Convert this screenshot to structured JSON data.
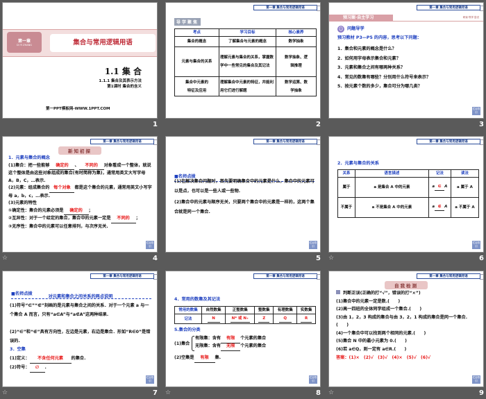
{
  "header_badge": "第一章 集合与常用逻辑用语",
  "nav_label": "栏目导引",
  "slides": [
    {
      "number": "1",
      "chapter": "第一章",
      "chapter_pinyin": "DI YI ZHANG",
      "chapter_title": "集合与常用逻辑用语",
      "section": "1.1 集 合",
      "subsection": "1.1.1 集合及其表示方法",
      "lesson": "第1课时 集合的含义",
      "footer": "第一PPT模板网-WWW.1PPT.COM"
    },
    {
      "number": "2",
      "tag": "导学聚焦",
      "headers": [
        "考点",
        "学习目标",
        "核心素养"
      ],
      "rows": [
        [
          "集合的概念",
          "了解集合与元素的概念",
          "数学抽象"
        ],
        [
          "元素与集合的关系",
          "理解元素与集合的关系，掌握数学中一些常见的集合及其记法",
          "数学抽象、逻辑推理"
        ],
        [
          "集合中元素的特征及应用",
          "理解集合中元素的特征，并能利用它们进行解题",
          "数学运算、数学抽象"
        ]
      ]
    },
    {
      "number": "3",
      "banner": "预习案·自主学习",
      "banner_right": "研读·导学·尝试",
      "heading": "问题导学",
      "intro": "预习教材 P3—P5 的内容，思考以下问题：",
      "questions": [
        "1．集合和元素的概念是什么？",
        "2．如何用字母表示集合和元素？",
        "3．元素和集合之间有哪两种关系？",
        "4．常见的数集有哪些？分别用什么符号来表示？",
        "5．按元素个数的多少，集合可分为哪几类？"
      ]
    },
    {
      "number": "4",
      "ribbon": "新知初探",
      "heading": "1．元素与集合的概念",
      "l1a": "(1)集合：把一些能够",
      "b1": "确定的",
      "l1b": "、",
      "b2": "不同的",
      "l1c": "对象看成一个整体，就说这个整体是由这些对象组成的集合(有时简称为集)，通常用英文大写字母 A，B，C，…表示.",
      "l2a": "(2)元素：组成集合的",
      "b3": "每个对象",
      "l2b": "都是这个集合的元素，通常用英文小写字母 a，b，c，…表示.",
      "l3": "(3)元素的特性",
      "l4a": "①确定性：集合的元素必须是",
      "b4": "确定的",
      "l4b": "；",
      "l5": "②互异性：对于一个给定的集合，集合中的元素一定是",
      "b5": "不同的",
      "l5b": "；",
      "l6": "③无序性：集合中的元素可以任意排列，与次序无关."
    },
    {
      "number": "5",
      "heading": "■名师点拨",
      "p1": "(1)在解决集合问题时，首先要明确集合中的元素是什么，集合中的元素可以是点，也可以是一些人或一些物.",
      "p2": "(2)集合中的元素与顺序无关，只要两个集合中的元素是一样的，这两个集合就是同一个集合."
    },
    {
      "number": "6",
      "heading": "2．元素与集合的关系",
      "headers": [
        "关系",
        "语言描述",
        "记法",
        "读法"
      ],
      "rows": [
        [
          "属于",
          "a 是集合 A 中的元素",
          "a",
          "∈",
          "A",
          "a 属于 A"
        ],
        [
          "不属于",
          "a 不是集合 A 中的元素",
          "a",
          "∉",
          "A",
          "a 不属于 A"
        ]
      ]
    },
    {
      "number": "7",
      "heading": "■名师点拨",
      "subheading": "对元素和集合之间关系的两点说明",
      "p1": "(1)符号“∈”“∉”刻画的是元素与集合之间的关系．对于一个元素 a 与一个集合 A 而言，只有“a∈A”与“a∉A”这两种结果.",
      "p2": "(2)“∈”和“∉”具有方向性，左边是元素，右边是集合．形如“R∈0”是错误的.",
      "h2": "3．空集",
      "d1a": "(1)定义：",
      "d1b": "不含任何元素",
      "d1c": "的集合.",
      "d2a": "(2)符号：",
      "d2b": "∅",
      "d2c": "."
    },
    {
      "number": "8",
      "heading": "4．常用的数集及其记法",
      "headers": [
        "常用的数集",
        "自然数集",
        "正整数集",
        "整数集",
        "有理数集",
        "实数集"
      ],
      "row": [
        "记法",
        "N",
        "N* 或 N₊",
        "Z",
        "Q",
        "R"
      ],
      "h2": "5.集合的分类",
      "c1": "(1)集合",
      "c1a": "有限集：含有",
      "c1ab": "有限",
      "c1b": "无限集：含有",
      "c1bb": "无限",
      "c1tail": "个元素的集合",
      "c2a": "(2)空集是",
      "c2b": "有限",
      "c2c": "集."
    },
    {
      "number": "9",
      "ribbon": "自我检测",
      "intro": "判断正误(正确的打“√”，错误的打“×”)",
      "items": [
        "(1)集合中的元素一定是数.(　　)",
        "(2)高一四班的全体同学组成一个集合.(　　)",
        "(3)由 1，2，3 构成的集合与由 3，2，1 构成的集合是同一个集合.(　　)",
        "(4)一个集合中可以找到两个相同的元素.(　　)",
        "(5)集合 N 中的最小元素为 0.(　　)",
        "(6)若 a∈Q，则一定有 a∈R.(　　)"
      ],
      "answer": "答案：(1)×　(2)√　(3)√　(4)×　(5)√　(6)√"
    }
  ]
}
